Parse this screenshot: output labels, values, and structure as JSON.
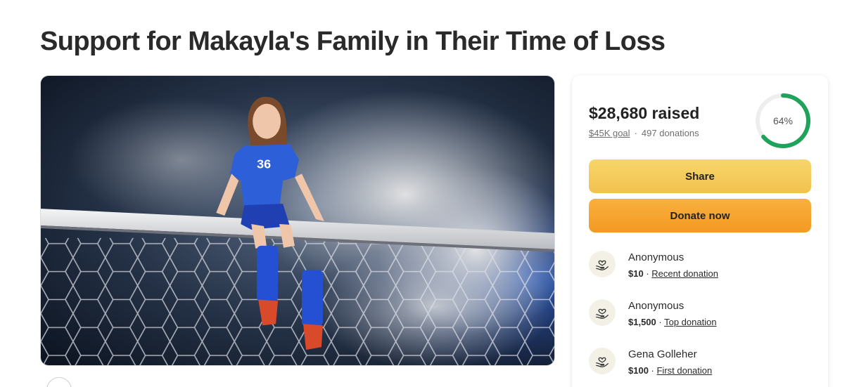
{
  "page": {
    "title": "Support for Makayla's Family in Their Time of Loss"
  },
  "hero": {
    "jersey_number": "36"
  },
  "donation_card": {
    "raised_amount": "$28,680",
    "raised_word": "raised",
    "goal": "$45K goal",
    "separator": "·",
    "donation_count": "497 donations",
    "progress_percent": 64,
    "progress_label": "64%",
    "share_label": "Share",
    "donate_label": "Donate now",
    "donations": [
      {
        "name": "Anonymous",
        "amount": "$10",
        "separator": " · ",
        "tag": "Recent donation"
      },
      {
        "name": "Anonymous",
        "amount": "$1,500",
        "separator": " · ",
        "tag": "Top donation"
      },
      {
        "name": "Gena Golleher",
        "amount": "$100",
        "separator": " · ",
        "tag": "First donation"
      }
    ]
  },
  "colors": {
    "progress_green": "#1fa35a",
    "share_yellow": "#f2c14e",
    "donate_orange": "#f39a22"
  },
  "icons": {
    "donor_icon": "heart-in-hand-icon"
  }
}
